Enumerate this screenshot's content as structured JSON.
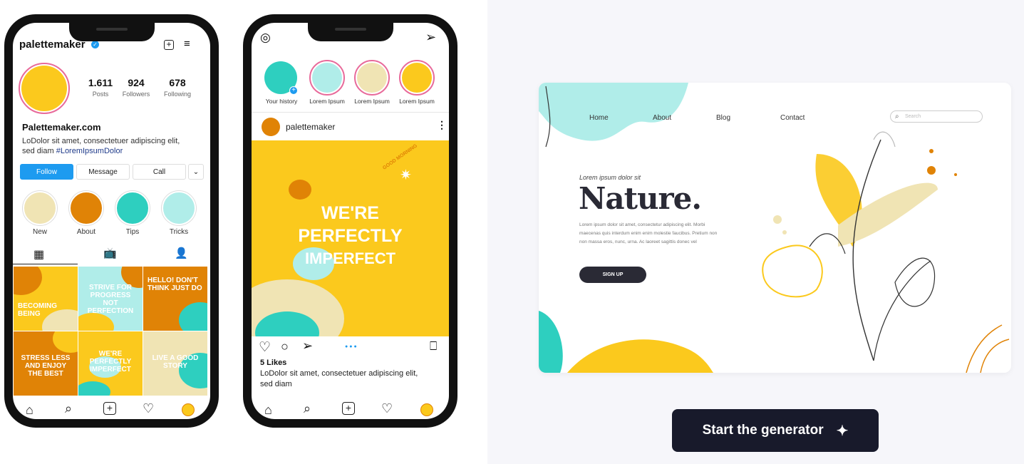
{
  "profile_phone": {
    "username": "palettemaker",
    "stats": [
      {
        "value": "1.611",
        "label": "Posts"
      },
      {
        "value": "924",
        "label": "Followers"
      },
      {
        "value": "678",
        "label": "Following"
      }
    ],
    "display_name": "Palettemaker.com",
    "bio_line1": "LoDolor sit amet, consectetuer adipiscing elit,",
    "bio_line2": "sed diam",
    "bio_hashtag": "#LoremIpsumDolor",
    "buttons": {
      "follow": "Follow",
      "message": "Message",
      "call": "Call"
    },
    "highlights": [
      "New",
      "About",
      "Tips",
      "Tricks"
    ],
    "tiles": [
      {
        "text": "BECOMING BEING",
        "color": "#fbc91d"
      },
      {
        "text": "STRIVE FOR PROGRESS NOT PERFECTION",
        "color": "#b0ede9"
      },
      {
        "text": "HELLO! DON'T THINK JUST DO",
        "color": "#e08306"
      },
      {
        "text": "STRESS LESS AND ENJOY THE BEST",
        "color": "#e08306"
      },
      {
        "text": "WE'RE PERFECTLY IMPERFECT",
        "color": "#fbc91d"
      },
      {
        "text": "LIVE A GOOD STORY",
        "color": "#f0e4b4"
      }
    ]
  },
  "feed_phone": {
    "stories": [
      "Your history",
      "Lorem Ipsum",
      "Lorem Ipsum",
      "Lorem Ipsum"
    ],
    "post_user": "palettemaker",
    "post_text_line1": "WE'RE",
    "post_text_line2": "PERFECTLY",
    "post_text_line3": "IMPERFECT",
    "post_badge": "GOOD MORNING",
    "likes": "5 Likes",
    "caption_line1": "LoDolor sit amet, consectetuer adipiscing elit,",
    "caption_line2": "sed diam"
  },
  "website_mock": {
    "nav": [
      "Home",
      "About",
      "Blog",
      "Contact"
    ],
    "search_placeholder": "Search",
    "eyebrow": "Lorem ipsum dolor sit",
    "headline": "Nature.",
    "body": "Lorem ipsum dolor sit amet, consectetur adipiscing elit. Morbi maecenas quis interdum enim enim molestie faucibus. Pretium non non massa eros, nunc, urna. Ac laoreet sagittis donec vel",
    "signup": "SIGN UP"
  },
  "cta": {
    "label": "Start the generator"
  },
  "colors": {
    "yellow": "#fbc91d",
    "orange": "#e08306",
    "teal": "#2ecfbf",
    "light_teal": "#b0ede9",
    "cream": "#f0e4b4",
    "dark": "#181a2b"
  }
}
